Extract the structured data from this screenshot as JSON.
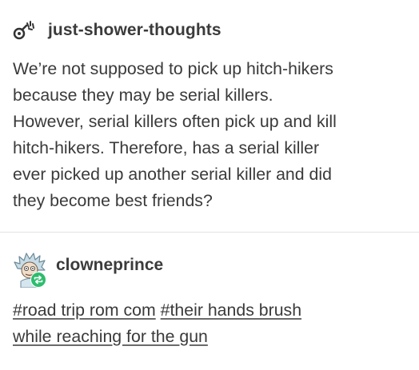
{
  "original_post": {
    "username": "just-shower-thoughts",
    "avatar_icon": "shower-head-icon",
    "body_lines": [
      "We’re not supposed to pick up hitch-hikers",
      "because they may be serial killers.",
      "However, serial killers often pick up and kill",
      "hitch-hikers. Therefore, has a serial killer",
      "ever picked up another serial killer and did",
      "they become best friends?"
    ]
  },
  "reblog": {
    "username": "clowneprince",
    "avatar_icon": "rick-avatar-icon",
    "badge_icon": "reblog-icon",
    "badge_color": "#2dbd6e",
    "tag_lines": {
      "line1_tag1": "#road trip rom com",
      "line1_tag2_part": "#their hands brush",
      "line2_tag2_part": "while reaching for the gun"
    }
  }
}
